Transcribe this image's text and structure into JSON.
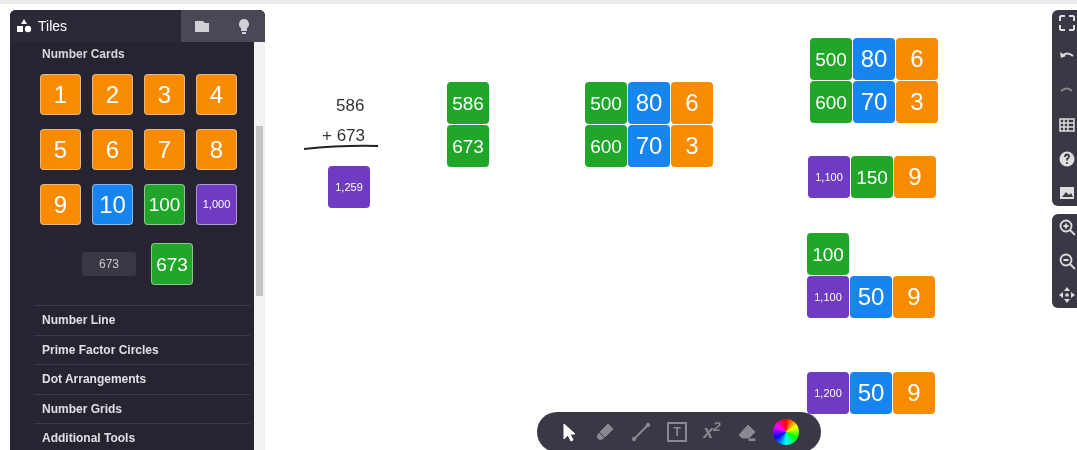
{
  "sidebar": {
    "tabs": [
      {
        "kind": "tiles",
        "label": "Tiles",
        "selected": true
      },
      {
        "kind": "folder",
        "selected": false
      },
      {
        "kind": "bulb",
        "selected": false
      }
    ],
    "section_title": "Number Cards",
    "cards": [
      {
        "label": "1",
        "color": "#f98b00"
      },
      {
        "label": "2",
        "color": "#f98b00"
      },
      {
        "label": "3",
        "color": "#f98b00"
      },
      {
        "label": "4",
        "color": "#f98b00"
      },
      {
        "label": "5",
        "color": "#f98b00"
      },
      {
        "label": "6",
        "color": "#f98b00"
      },
      {
        "label": "7",
        "color": "#f98b00"
      },
      {
        "label": "8",
        "color": "#f98b00"
      },
      {
        "label": "9",
        "color": "#f98b00"
      },
      {
        "label": "10",
        "color": "#1785f0"
      },
      {
        "label": "100",
        "color": "#20a72a"
      },
      {
        "label": "1,000",
        "color": "#6f3bc2"
      }
    ],
    "custom_input": {
      "value": "673"
    },
    "custom_card": {
      "label": "673",
      "color": "#20a72a"
    },
    "sections": [
      "Number Line",
      "Prime Factor Circles",
      "Dot Arrangements",
      "Number Grids",
      "Additional Tools"
    ]
  },
  "canvas": {
    "written_sum": {
      "lines": [
        "586",
        "+ 673"
      ]
    },
    "tile_groups": [
      {
        "rows": [
          [
            {
              "label": "1,259",
              "color": "#6f3bc2"
            }
          ]
        ]
      },
      {
        "rows": [
          [
            {
              "label": "586",
              "color": "#20a72a"
            }
          ],
          [
            {
              "label": "673",
              "color": "#20a72a"
            }
          ]
        ]
      },
      {
        "rows": [
          [
            {
              "label": "500",
              "color": "#20a72a"
            },
            {
              "label": "80",
              "color": "#1785f0"
            },
            {
              "label": "6",
              "color": "#f98b00"
            }
          ],
          [
            {
              "label": "600",
              "color": "#20a72a"
            },
            {
              "label": "70",
              "color": "#1785f0"
            },
            {
              "label": "3",
              "color": "#f98b00"
            }
          ]
        ]
      },
      {
        "rows": [
          [
            {
              "label": "500",
              "color": "#20a72a"
            },
            {
              "label": "80",
              "color": "#1785f0"
            },
            {
              "label": "6",
              "color": "#f98b00"
            }
          ],
          [
            {
              "label": "600",
              "color": "#20a72a"
            },
            {
              "label": "70",
              "color": "#1785f0"
            },
            {
              "label": "3",
              "color": "#f98b00"
            }
          ]
        ]
      },
      {
        "rows": [
          [
            {
              "label": "1,100",
              "color": "#6f3bc2"
            },
            {
              "label": "150",
              "color": "#20a72a"
            },
            {
              "label": "9",
              "color": "#f98b00"
            }
          ]
        ]
      },
      {
        "rows": [
          [
            {
              "label": "100",
              "color": "#20a72a"
            }
          ],
          [
            {
              "label": "1,100",
              "color": "#6f3bc2"
            },
            {
              "label": "50",
              "color": "#1785f0"
            },
            {
              "label": "9",
              "color": "#f98b00"
            }
          ]
        ]
      },
      {
        "rows": [
          [
            {
              "label": "1,200",
              "color": "#6f3bc2"
            },
            {
              "label": "50",
              "color": "#1785f0"
            },
            {
              "label": "9",
              "color": "#f98b00"
            }
          ]
        ]
      }
    ]
  },
  "right_toolbar": {
    "groups": [
      {
        "tools": [
          {
            "kind": "fullscreen"
          },
          {
            "kind": "undo"
          },
          {
            "kind": "redo"
          },
          {
            "kind": "grid"
          },
          {
            "kind": "help"
          },
          {
            "kind": "image"
          }
        ]
      },
      {
        "tools": [
          {
            "kind": "zoom-in"
          },
          {
            "kind": "zoom-out"
          },
          {
            "kind": "move"
          }
        ]
      }
    ]
  },
  "bottom_toolbar": {
    "tools": [
      {
        "kind": "pointer",
        "selected": true
      },
      {
        "kind": "pen",
        "selected": false
      },
      {
        "kind": "line",
        "selected": false
      },
      {
        "kind": "text",
        "label": "T",
        "selected": false
      },
      {
        "kind": "math",
        "label": "x$^{2}$",
        "selected": false
      },
      {
        "kind": "eraser",
        "selected": false
      },
      {
        "kind": "color",
        "selected": false
      }
    ]
  }
}
